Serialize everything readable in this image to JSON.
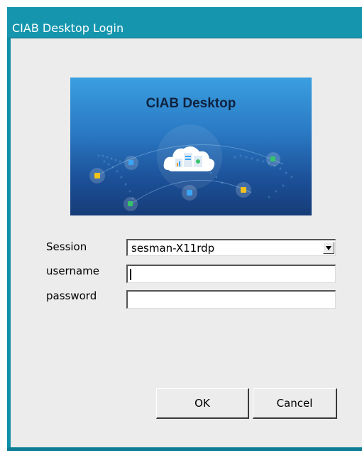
{
  "window": {
    "title": "CIAB Desktop Login"
  },
  "banner": {
    "title": "CIAB Desktop"
  },
  "form": {
    "session_label": "Session",
    "session_value": "sesman-X11rdp",
    "username_label": "username",
    "username_value": "",
    "password_label": "password",
    "password_value": ""
  },
  "buttons": {
    "ok_label": "OK",
    "cancel_label": "Cancel"
  },
  "colors": {
    "titlebar": "#1596ae",
    "frame": "#0f8fa8",
    "client_bg": "#ececec"
  }
}
